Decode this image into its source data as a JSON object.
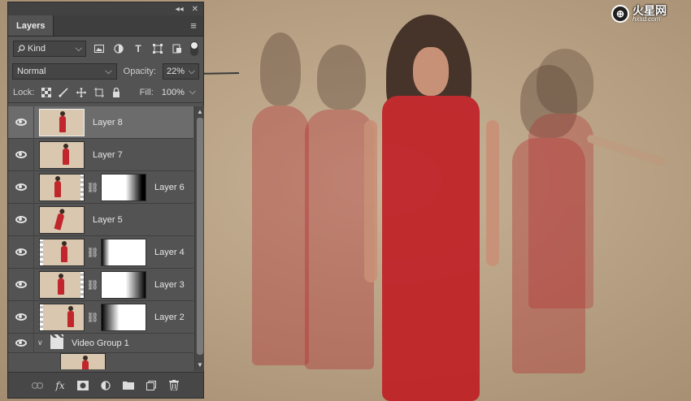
{
  "watermark": {
    "brand": "火星网",
    "domain": "hxsd.com",
    "logo_letter": "⊕"
  },
  "panel": {
    "title_controls": {
      "collapse": "◂◂",
      "close": "✕"
    },
    "tab_label": "Layers",
    "menu_icon": "≡",
    "filter": {
      "kind_label": "Kind",
      "icons": [
        "image-filter-icon",
        "adjustment-filter-icon",
        "type-filter-icon",
        "shape-filter-icon",
        "smart-object-filter-icon"
      ]
    },
    "blend": {
      "mode": "Normal",
      "opacity_label": "Opacity:",
      "opacity_value": "22%"
    },
    "lock": {
      "label": "Lock:",
      "fill_label": "Fill:",
      "fill_value": "100%"
    },
    "layers": [
      {
        "name": "Layer 8",
        "selected": true,
        "has_mask": false
      },
      {
        "name": "Layer 7",
        "selected": false,
        "has_mask": false
      },
      {
        "name": "Layer 6",
        "selected": false,
        "has_mask": true
      },
      {
        "name": "Layer 5",
        "selected": false,
        "has_mask": false
      },
      {
        "name": "Layer 4",
        "selected": false,
        "has_mask": true
      },
      {
        "name": "Layer 3",
        "selected": false,
        "has_mask": true
      },
      {
        "name": "Layer 2",
        "selected": false,
        "has_mask": true
      }
    ],
    "group": {
      "name": "Video Group 1"
    },
    "bottom_icons": [
      "link-layers-icon",
      "fx-icon",
      "add-mask-icon",
      "adjustment-layer-icon",
      "new-group-icon",
      "new-layer-icon",
      "delete-layer-icon"
    ]
  },
  "colors": {
    "panel_bg": "#535353",
    "selected_row": "#6c6c6c",
    "dress_red": "#b3262b"
  }
}
